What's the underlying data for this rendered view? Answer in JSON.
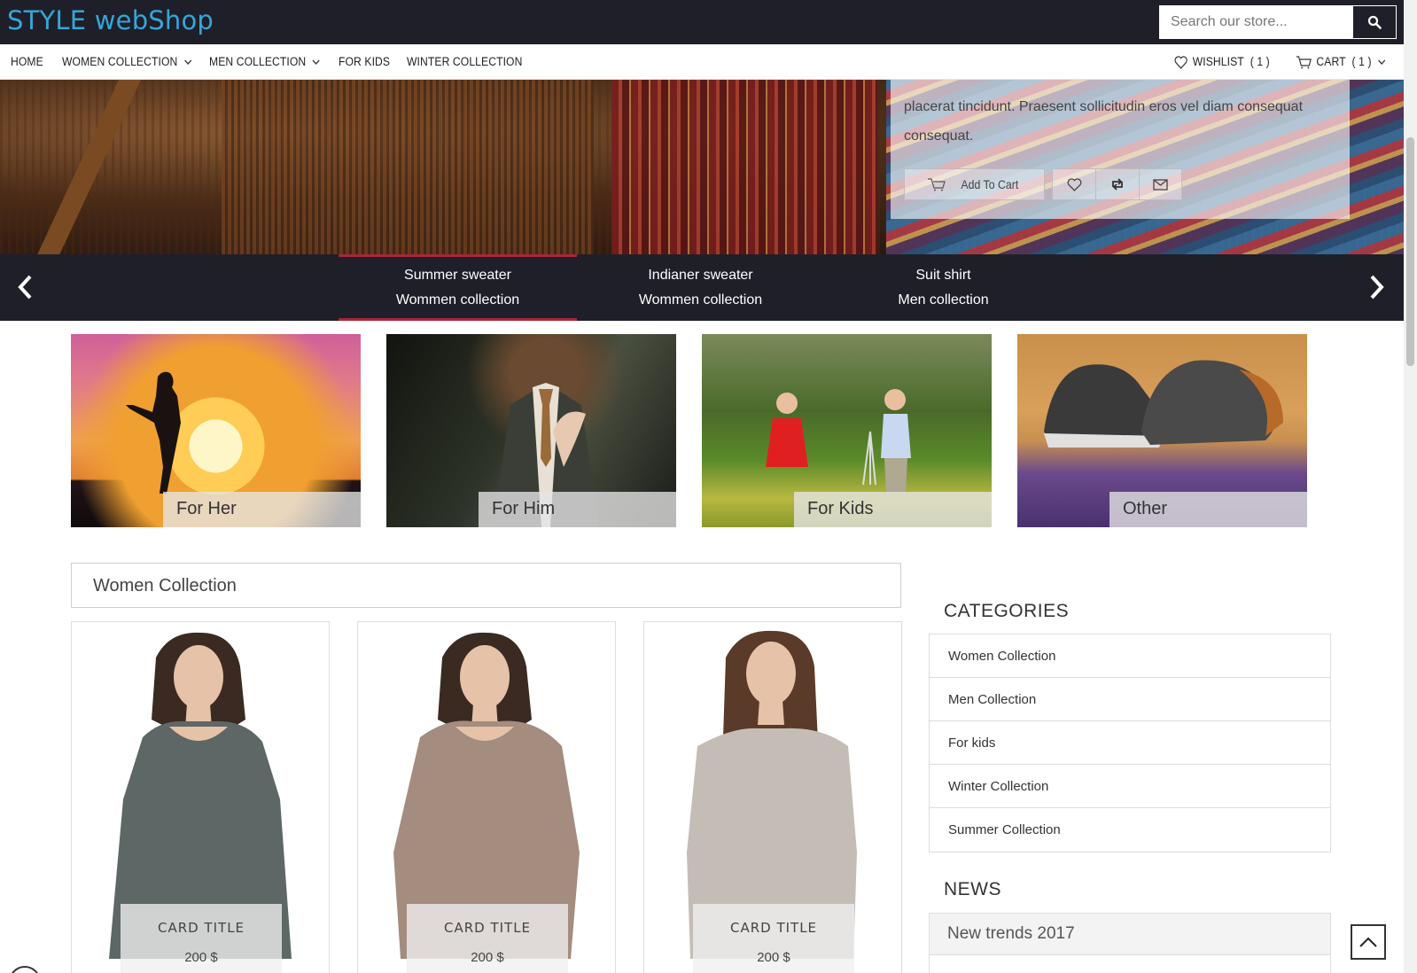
{
  "header": {
    "logo": "STYLE webShop",
    "search_placeholder": "Search our store..."
  },
  "nav": {
    "items": [
      {
        "label": "HOME",
        "dropdown": false
      },
      {
        "label": "WOMEN COLLECTION",
        "dropdown": true
      },
      {
        "label": "MEN COLLECTION",
        "dropdown": true
      },
      {
        "label": "FOR KIDS",
        "dropdown": false
      },
      {
        "label": "WINTER COLLECTION",
        "dropdown": false
      }
    ],
    "wishlist": "WISHLIST",
    "wishlist_count": "( 1 )",
    "cart": "CART",
    "cart_count": "( 1 )"
  },
  "hero": {
    "description": "placerat tincidunt. Praesent sollicitudin eros vel diam consequat consequat.",
    "add_to_cart": "Add To Cart"
  },
  "slider": {
    "tabs": [
      {
        "title": "Summer sweater",
        "subtitle": "Wommen collection",
        "active": true
      },
      {
        "title": "Indianer sweater",
        "subtitle": "Wommen collection",
        "active": false
      },
      {
        "title": "Suit shirt",
        "subtitle": "Men collection",
        "active": false
      }
    ]
  },
  "categories_tiles": [
    {
      "label": "For Her"
    },
    {
      "label": "For Him"
    },
    {
      "label": "For Kids"
    },
    {
      "label": "Other"
    }
  ],
  "women_collection": {
    "title": "Women Collection",
    "cards": [
      {
        "title": "CARD TITLE",
        "price": "200 $",
        "shirt_color": "#5d6866"
      },
      {
        "title": "CARD TITLE",
        "price": "200 $",
        "shirt_color": "#a48c7e"
      },
      {
        "title": "CARD TITLE",
        "price": "200 $",
        "shirt_color": "#c4bdb6"
      }
    ]
  },
  "sidebar": {
    "categories_heading": "CATEGORIES",
    "categories": [
      "Women Collection",
      "Men Collection",
      "For kids",
      "Winter Collection",
      "Summer Collection"
    ],
    "news_heading": "NEWS",
    "news_item": "New trends 2017"
  },
  "colors": {
    "topbar": "#1f1f29",
    "logo": "#35a6d9",
    "accent": "#a8263a"
  }
}
